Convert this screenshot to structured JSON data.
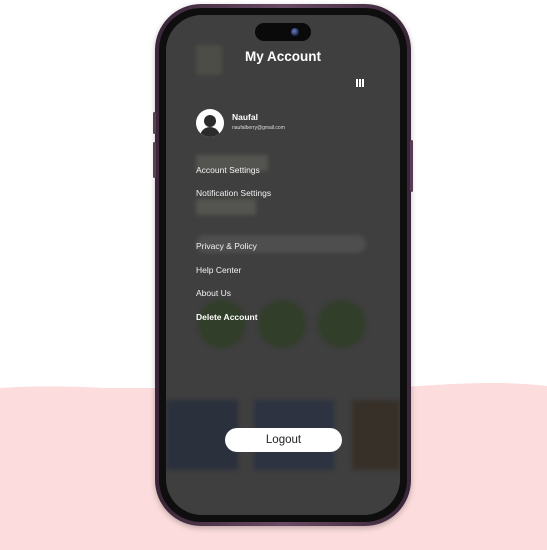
{
  "screen": {
    "title": "My Account"
  },
  "profile": {
    "name": "Naufal",
    "email": "naufalberry@gmail.com"
  },
  "menu": {
    "account_settings": "Account Settings",
    "notification_settings": "Notification Settings",
    "privacy_policy": "Privacy & Policy",
    "help_center": "Help Center",
    "about_us": "About Us",
    "delete_account": "Delete Account"
  },
  "logout_label": "Logout",
  "colors": {
    "background_wave": "#fcdcdc",
    "phone_frame": "#5a3c55",
    "overlay": "#3a3a3a",
    "text": "#ffffff"
  },
  "icons": {
    "menu": "triple-bar-icon",
    "avatar": "user-avatar-icon"
  }
}
